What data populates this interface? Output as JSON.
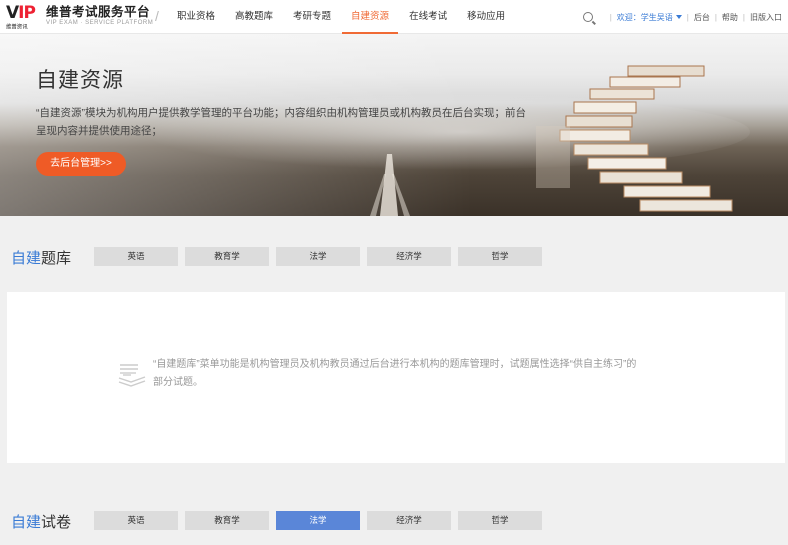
{
  "logo": {
    "mark_v": "V",
    "mark_ip": "IP",
    "small_text": "维普资讯",
    "name": "维普考试服务平台",
    "tagline": "VIP EXAM · SERVICE PLATFORM",
    "slash": "/"
  },
  "nav": {
    "items": [
      {
        "label": "职业资格",
        "active": false
      },
      {
        "label": "高教题库",
        "active": false
      },
      {
        "label": "考研专题",
        "active": false
      },
      {
        "label": "自建资源",
        "active": true
      },
      {
        "label": "在线考试",
        "active": false
      },
      {
        "label": "移动应用",
        "active": false
      }
    ]
  },
  "header_right": {
    "welcome": "欢迎：学生吴语",
    "backend": "后台",
    "help": "帮助",
    "old_version": "旧版入口",
    "sep": "|"
  },
  "banner": {
    "title": "自建资源",
    "description": "“自建资源”模块为机构用户提供教学管理的平台功能；内容组织由机构管理员或机构教员在后台实现；前台呈现内容并提供使用途径；",
    "button": "去后台管理>>"
  },
  "question_bank": {
    "title_hl": "自建",
    "title_rest": "题库",
    "tabs": [
      "英语",
      "教育学",
      "法学",
      "经济学",
      "哲学"
    ],
    "active_tab": -1,
    "notice": "“自建题库”菜单功能是机构管理员及机构教员通过后台进行本机构的题库管理时，试题属性选择“供自主练习”的部分试题。"
  },
  "exam_papers": {
    "title_hl": "自建",
    "title_rest": "试卷",
    "tabs": [
      "英语",
      "教育学",
      "法学",
      "经济学",
      "哲学"
    ],
    "active_tab": 2
  },
  "colors": {
    "accent_orange": "#ef5b26",
    "accent_blue": "#3a7bd5",
    "active_tab_blue": "#5a86d8"
  }
}
